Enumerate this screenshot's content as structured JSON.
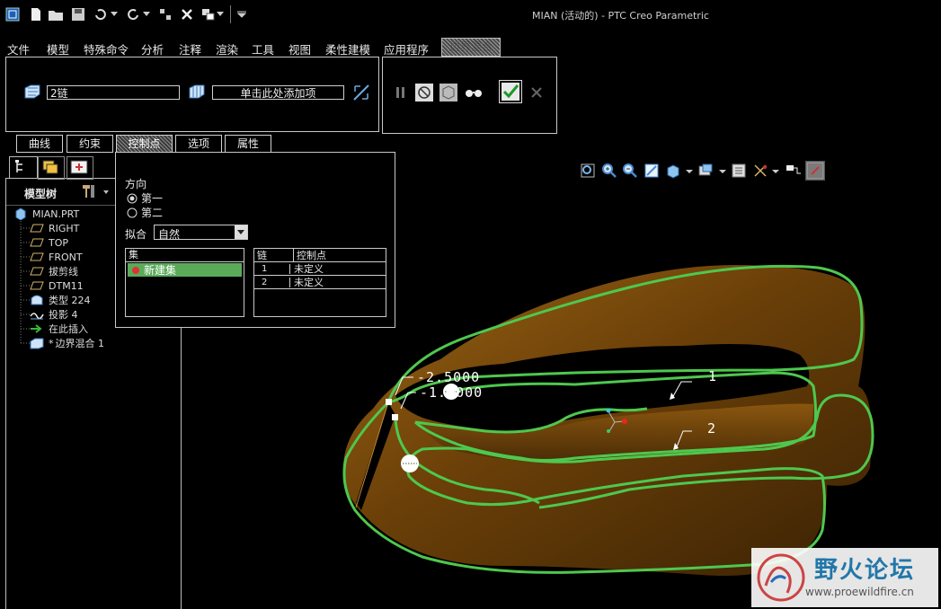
{
  "window": {
    "title": "MIAN (活动的) - PTC Creo Parametric"
  },
  "menu": {
    "items": [
      "文件",
      "模型",
      "特殊命令",
      "分析",
      "注释",
      "渲染",
      "工具",
      "视图",
      "柔性建模",
      "应用程序"
    ],
    "active_tab_label": "边界混合"
  },
  "dashboard": {
    "chain1_value": "2链",
    "chain2_value": "单击此处添加项"
  },
  "subtabs": {
    "curves": "曲线",
    "constraints": "约束",
    "control_points": "控制点",
    "options": "选项",
    "properties": "属性"
  },
  "control_panel": {
    "direction_label": "方向",
    "direction_first": "第一",
    "direction_second": "第二",
    "fit_label": "拟合",
    "fit_value": "自然",
    "sets_header": "集",
    "sets_item": "新建集",
    "chain_header": "链",
    "ctrlpt_header": "控制点",
    "rows": [
      {
        "chain": "1",
        "ctrl": "未定义"
      },
      {
        "chain": "2",
        "ctrl": "未定义"
      }
    ]
  },
  "model_tree": {
    "label": "模型树",
    "items": [
      {
        "label": "MIAN.PRT",
        "icon": "part-icon"
      },
      {
        "label": "RIGHT",
        "icon": "datum-plane-icon"
      },
      {
        "label": "TOP",
        "icon": "datum-plane-icon"
      },
      {
        "label": "FRONT",
        "icon": "datum-plane-icon"
      },
      {
        "label": "拔剪线",
        "icon": "datum-plane-icon"
      },
      {
        "label": "DTM11",
        "icon": "datum-plane-icon"
      },
      {
        "label": "类型 224",
        "icon": "surface-icon"
      },
      {
        "label": "投影 4",
        "icon": "projection-icon"
      },
      {
        "label": "在此插入",
        "icon": "insert-arrow-icon"
      },
      {
        "label": "边界混合 1",
        "icon": "boundary-blend-icon"
      }
    ]
  },
  "viewport": {
    "dim1": "-2.5000",
    "dim2": "-1.0000",
    "chain_label_1": "1",
    "chain_label_2": "2"
  },
  "watermark": {
    "name": "野火论坛",
    "url": "www.proewildfire.cn"
  },
  "colors": {
    "curve": "#4ec84e",
    "surface": "#7a4a0c",
    "panel_border": "#c8c8c8",
    "highlight": "#5aaa5a"
  }
}
